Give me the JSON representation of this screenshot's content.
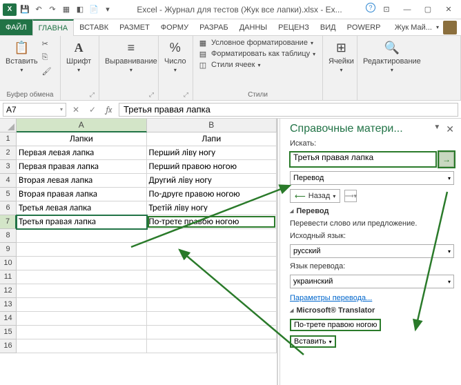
{
  "titlebar": {
    "title": "Excel - Журнал для тестов (Жук все лапки).xlsx - Ex..."
  },
  "tabs": {
    "file": "ФАЙЛ",
    "list": [
      "ГЛАВНА",
      "ВСТАВК",
      "РАЗМЕТ",
      "ФОРМУ",
      "РАЗРАБ",
      "ДАННЫ",
      "РЕЦЕНЗ",
      "ВИД",
      "POWERP"
    ],
    "active_index": 0,
    "user": "Жук Май..."
  },
  "ribbon": {
    "paste": "Вставить",
    "clipboard_label": "Буфер обмена",
    "font": "Шрифт",
    "alignment": "Выравнивание",
    "number": "Число",
    "styles_label": "Стили",
    "cond_fmt": "Условное форматирование",
    "as_table": "Форматировать как таблицу",
    "cell_styles": "Стили ячеек",
    "cells": "Ячейки",
    "editing": "Редактирование"
  },
  "formula_bar": {
    "namebox": "A7",
    "value": "Третья правая лапка"
  },
  "sheet": {
    "columns": [
      "A",
      "B"
    ],
    "headers": [
      "Лапки",
      "Лапи"
    ],
    "rows": [
      [
        "Первая левая лапка",
        "Перший ліву ногу"
      ],
      [
        "Первая правая лапка",
        "Перший правою ногою"
      ],
      [
        "Вторая левая лапка",
        "Другий ліву ногу"
      ],
      [
        "Вторая правая лапка",
        "По-друге правою ногою"
      ],
      [
        "Третья левая лапка",
        "Третій ліву ногу"
      ],
      [
        "Третья правая лапка",
        "По-трете правою ногою"
      ]
    ],
    "active_cell": "A7",
    "highlighted_cell": "B7",
    "visible_rows": 16
  },
  "taskpane": {
    "title": "Справочные матери...",
    "search_label": "Искать:",
    "search_value": "Третья правая лапка",
    "category_label": "Перевод",
    "back": "Назад",
    "section_translate": "Перевод",
    "translate_hint": "Перевести слово или предложение.",
    "src_label": "Исходный язык:",
    "src_value": "русский",
    "tgt_label": "Язык перевода:",
    "tgt_value": "украинский",
    "options_link": "Параметры перевода...",
    "ms_translator": "Microsoft® Translator",
    "result": "По-трете правою ногою",
    "insert": "Вставить"
  }
}
